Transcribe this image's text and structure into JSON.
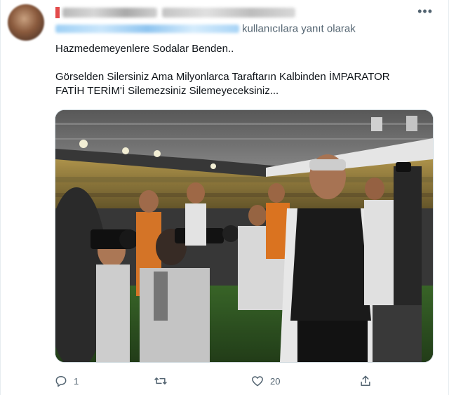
{
  "tweet": {
    "more_label": "•••",
    "reply_context": "kullanıcılara yanıt olarak",
    "text_line1": "Hazmedemeyenlere Sodalar Benden..",
    "text_line2": "Görselden Silersiniz Ama Milyonlarca Taraftarın Kalbinden İMPARATOR",
    "text_line3": "FATİH TERİM'İ Silemezsiniz Silemeyeceksiniz...",
    "actions": {
      "reply_count": "1",
      "like_count": "20"
    }
  },
  "colors": {
    "text": "#0f1419",
    "secondary": "#536471",
    "border": "#cfd9de"
  }
}
